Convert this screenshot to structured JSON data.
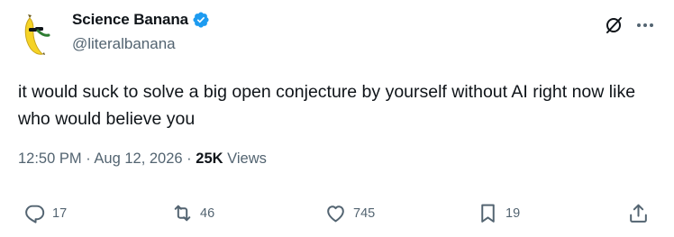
{
  "author": {
    "display_name": "Science Banana",
    "handle": "@literalbanana",
    "verified": true
  },
  "tweet": {
    "text": "it would suck to solve a big open conjecture by yourself without AI right now like who would believe you",
    "time": "12:50 PM",
    "separator": "·",
    "date": "Aug 12, 2026",
    "views_count": "25K",
    "views_label": "Views"
  },
  "actions": {
    "replies": "17",
    "reposts": "46",
    "likes": "745",
    "bookmarks": "19"
  },
  "icons": {
    "header": [
      "grok-icon",
      "more-icon"
    ],
    "actions": [
      "reply-icon",
      "repost-icon",
      "like-icon",
      "bookmark-icon",
      "share-icon"
    ]
  },
  "colors": {
    "text_primary": "#0f1419",
    "text_secondary": "#536471",
    "verified_blue": "#1d9bf0",
    "avatar_banana": "#f5d327"
  }
}
